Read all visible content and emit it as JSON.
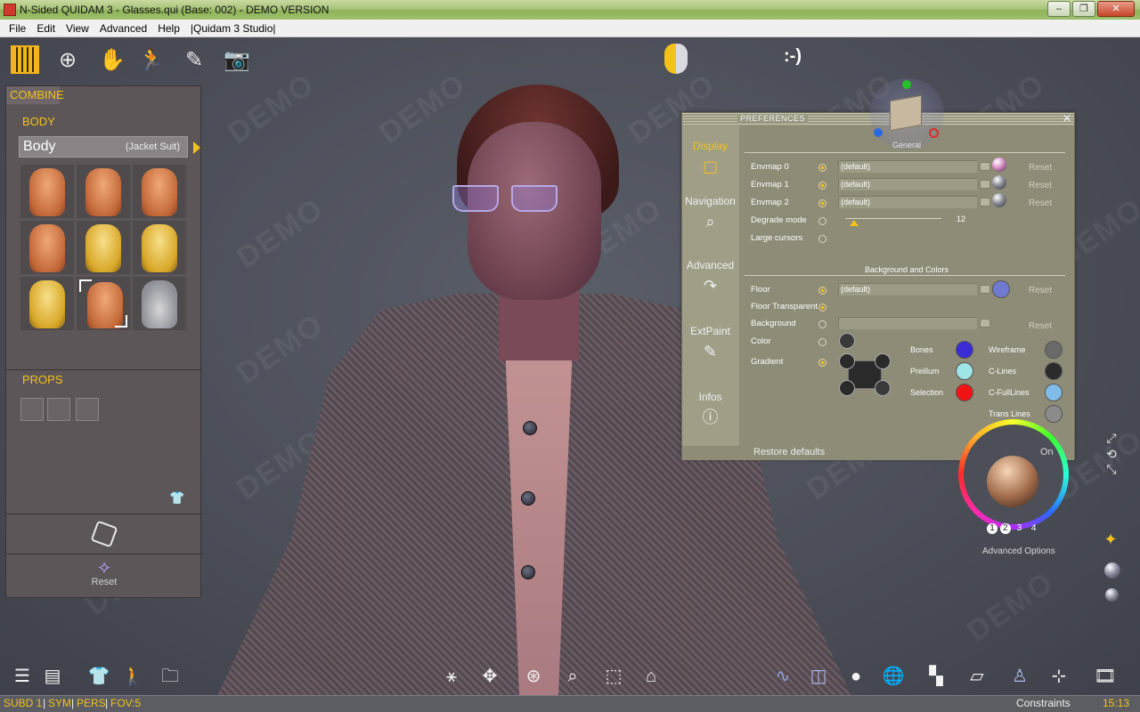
{
  "window": {
    "title": "N-Sided QUIDAM 3 - Glasses.qui (Base: 002) - DEMO VERSION",
    "min": "–",
    "max": "❐",
    "close": "✕"
  },
  "menu": [
    "File",
    "Edit",
    "View",
    "Advanced",
    "Help",
    "|Quidam 3 Studio|"
  ],
  "watermark": "DEMO",
  "top_toolbar": {
    "smiley": ":-)"
  },
  "left_panel": {
    "combine": "COMBINE",
    "body_section": "BODY",
    "body_name": "Body",
    "body_variant": "(Jacket Suit)",
    "props_section": "PROPS",
    "reset_label": "Reset"
  },
  "preferences": {
    "title": "PREFERENCES",
    "close": "✕",
    "tabs": [
      {
        "label": "Display",
        "icon": "▢"
      },
      {
        "label": "Navigation",
        "icon": "⌕"
      },
      {
        "label": "Advanced",
        "icon": "↷"
      },
      {
        "label": "ExtPaint",
        "icon": "✎"
      },
      {
        "label": "Infos",
        "icon": "ⓘ"
      }
    ],
    "general_label": "General",
    "rows": [
      {
        "label": "Envmap 0",
        "value": "(default)",
        "reset": "Reset"
      },
      {
        "label": "Envmap 1",
        "value": "(default)",
        "reset": "Reset"
      },
      {
        "label": "Envmap 2",
        "value": "(default)",
        "reset": "Reset"
      }
    ],
    "degrade_mode": "Degrade mode",
    "degrade_value": "12",
    "degrade_level": 0.09,
    "large_cursors": "Large cursors",
    "bg_section": "Background and Colors",
    "floor": {
      "label": "Floor",
      "value": "(default)",
      "reset": "Reset"
    },
    "floor_transparent": "Floor Transparent",
    "background": {
      "label": "Background",
      "value": "",
      "reset": "Reset"
    },
    "color": "Color",
    "gradient": "Gradient",
    "colors": [
      {
        "label": "Bones",
        "color": "#3b2bd6"
      },
      {
        "label": "Preillum",
        "color": "#9fe4e6"
      },
      {
        "label": "Selection",
        "color": "#f01414"
      },
      {
        "label": "Wireframe",
        "color": "#6a6a6a"
      },
      {
        "label": "C-Lines",
        "color": "#2b2b2b"
      },
      {
        "label": "C-FullLines",
        "color": "#7fbde8"
      },
      {
        "label": "Trans Lines",
        "color": "#8b8b8b"
      }
    ],
    "restore_defaults": "Restore defaults",
    "accent": "#f2c21b"
  },
  "advanced_options": {
    "numbers": [
      "1",
      "2",
      "3",
      "4"
    ],
    "label": "Advanced Options",
    "on": "On"
  },
  "status": {
    "subd": "SUBD 1",
    "sym": "SYM",
    "pers": "PERS",
    "fov": "FOV:5",
    "constraints": "Constraints",
    "time": "15:13"
  }
}
